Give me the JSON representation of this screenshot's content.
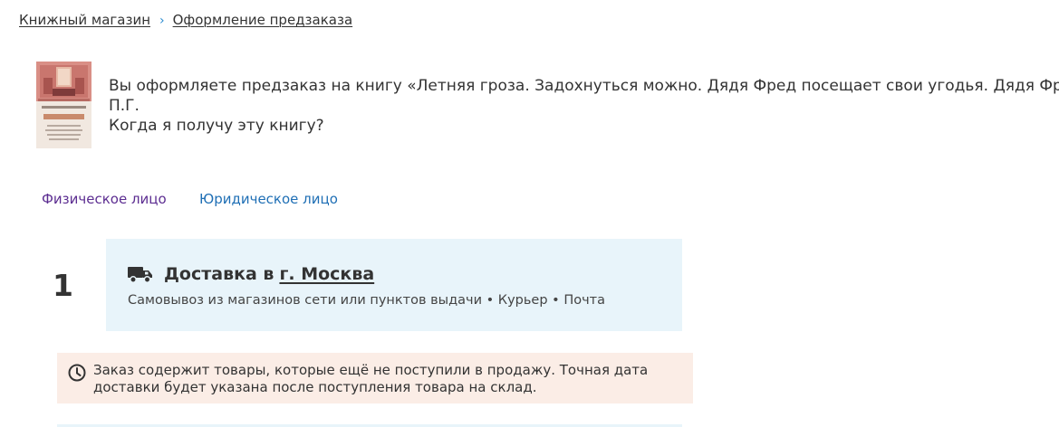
{
  "breadcrumb": {
    "items": [
      "Книжный магазин",
      "Оформление предзаказа"
    ],
    "separator": "›"
  },
  "book": {
    "cover_icon": "book-cover-image",
    "cover_lettering": [
      "Пелам Гренвилл Вудхаус",
      "P.G. Wodehouse"
    ],
    "line1": "Вы оформляете предзаказ на книгу «Летняя гроза. Задохнуться можно. Дядя Фред посещает свои угодья. Дядя Фред весенн",
    "line2": "П.Г.",
    "line3": "Когда я получу эту книгу?"
  },
  "tabs": {
    "individual": "Физическое лицо",
    "legal": "Юридическое лицо"
  },
  "step": {
    "number": "1",
    "title_prefix": "Доставка в",
    "city": "г. Москва",
    "truck_icon": "truck-icon",
    "methods": "Самовывоз из магазинов сети или пунктов выдачи • Курьер • Почта"
  },
  "warning": {
    "icon": "clock-icon",
    "line1": "Заказ содержит товары, которые ещё не поступили в продажу. Точная дата",
    "line2": "доставки будет указана после поступления товара на склад."
  },
  "colors": {
    "card_bg": "#e8f4fa",
    "warning_bg": "#fbede6",
    "link_visited": "#5c2d91",
    "link": "#1f6fb5",
    "separator": "#2a8bd0"
  }
}
